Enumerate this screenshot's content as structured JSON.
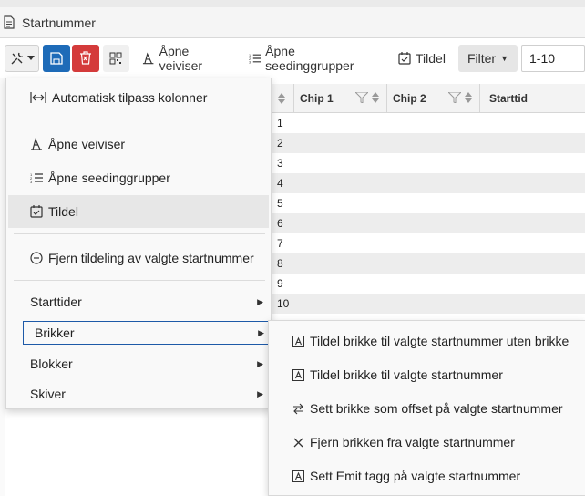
{
  "window": {
    "title": "Startnummer"
  },
  "toolbar": {
    "wizard_label": "Åpne veiviser",
    "seeding_label": "Åpne seedinggrupper",
    "assign_label": "Tildel",
    "filter_label": "Filter",
    "range_value": "1-10"
  },
  "grid": {
    "headers": {
      "chip1": "Chip 1",
      "chip2": "Chip 2",
      "starttime": "Starttid"
    },
    "rows": [
      "1",
      "2",
      "3",
      "4",
      "5",
      "6",
      "7",
      "8",
      "9",
      "10"
    ]
  },
  "menu": {
    "items": [
      {
        "label": "Automatisk tilpass kolonner",
        "icon": "fit-columns-icon"
      },
      {
        "label": "Åpne veiviser",
        "icon": "wizard-icon"
      },
      {
        "label": "Åpne seedinggrupper",
        "icon": "list-numbered-icon"
      },
      {
        "label": "Tildel",
        "icon": "calendar-check-icon"
      },
      {
        "label": "Fjern tildeling av valgte startnummer",
        "icon": "minus-circle-icon"
      },
      {
        "label": "Starttider"
      },
      {
        "label": "Brikker"
      },
      {
        "label": "Blokker"
      },
      {
        "label": "Skiver"
      }
    ]
  },
  "submenu": {
    "items": [
      {
        "label": "Tildel brikke til valgte startnummer uten brikke",
        "icon": "chip-icon"
      },
      {
        "label": "Tildel brikke til valgte startnummer",
        "icon": "chip-icon"
      },
      {
        "label": "Sett brikke som offset på valgte startnummer",
        "icon": "swap-icon"
      },
      {
        "label": "Fjern brikken fra valgte startnummer",
        "icon": "close-icon"
      },
      {
        "label": "Sett Emit tagg på valgte startnummer",
        "icon": "chip-icon"
      }
    ]
  },
  "colors": {
    "save": "#1e6bb8",
    "delete": "#d43b3b",
    "focus": "#1e5aa8"
  }
}
